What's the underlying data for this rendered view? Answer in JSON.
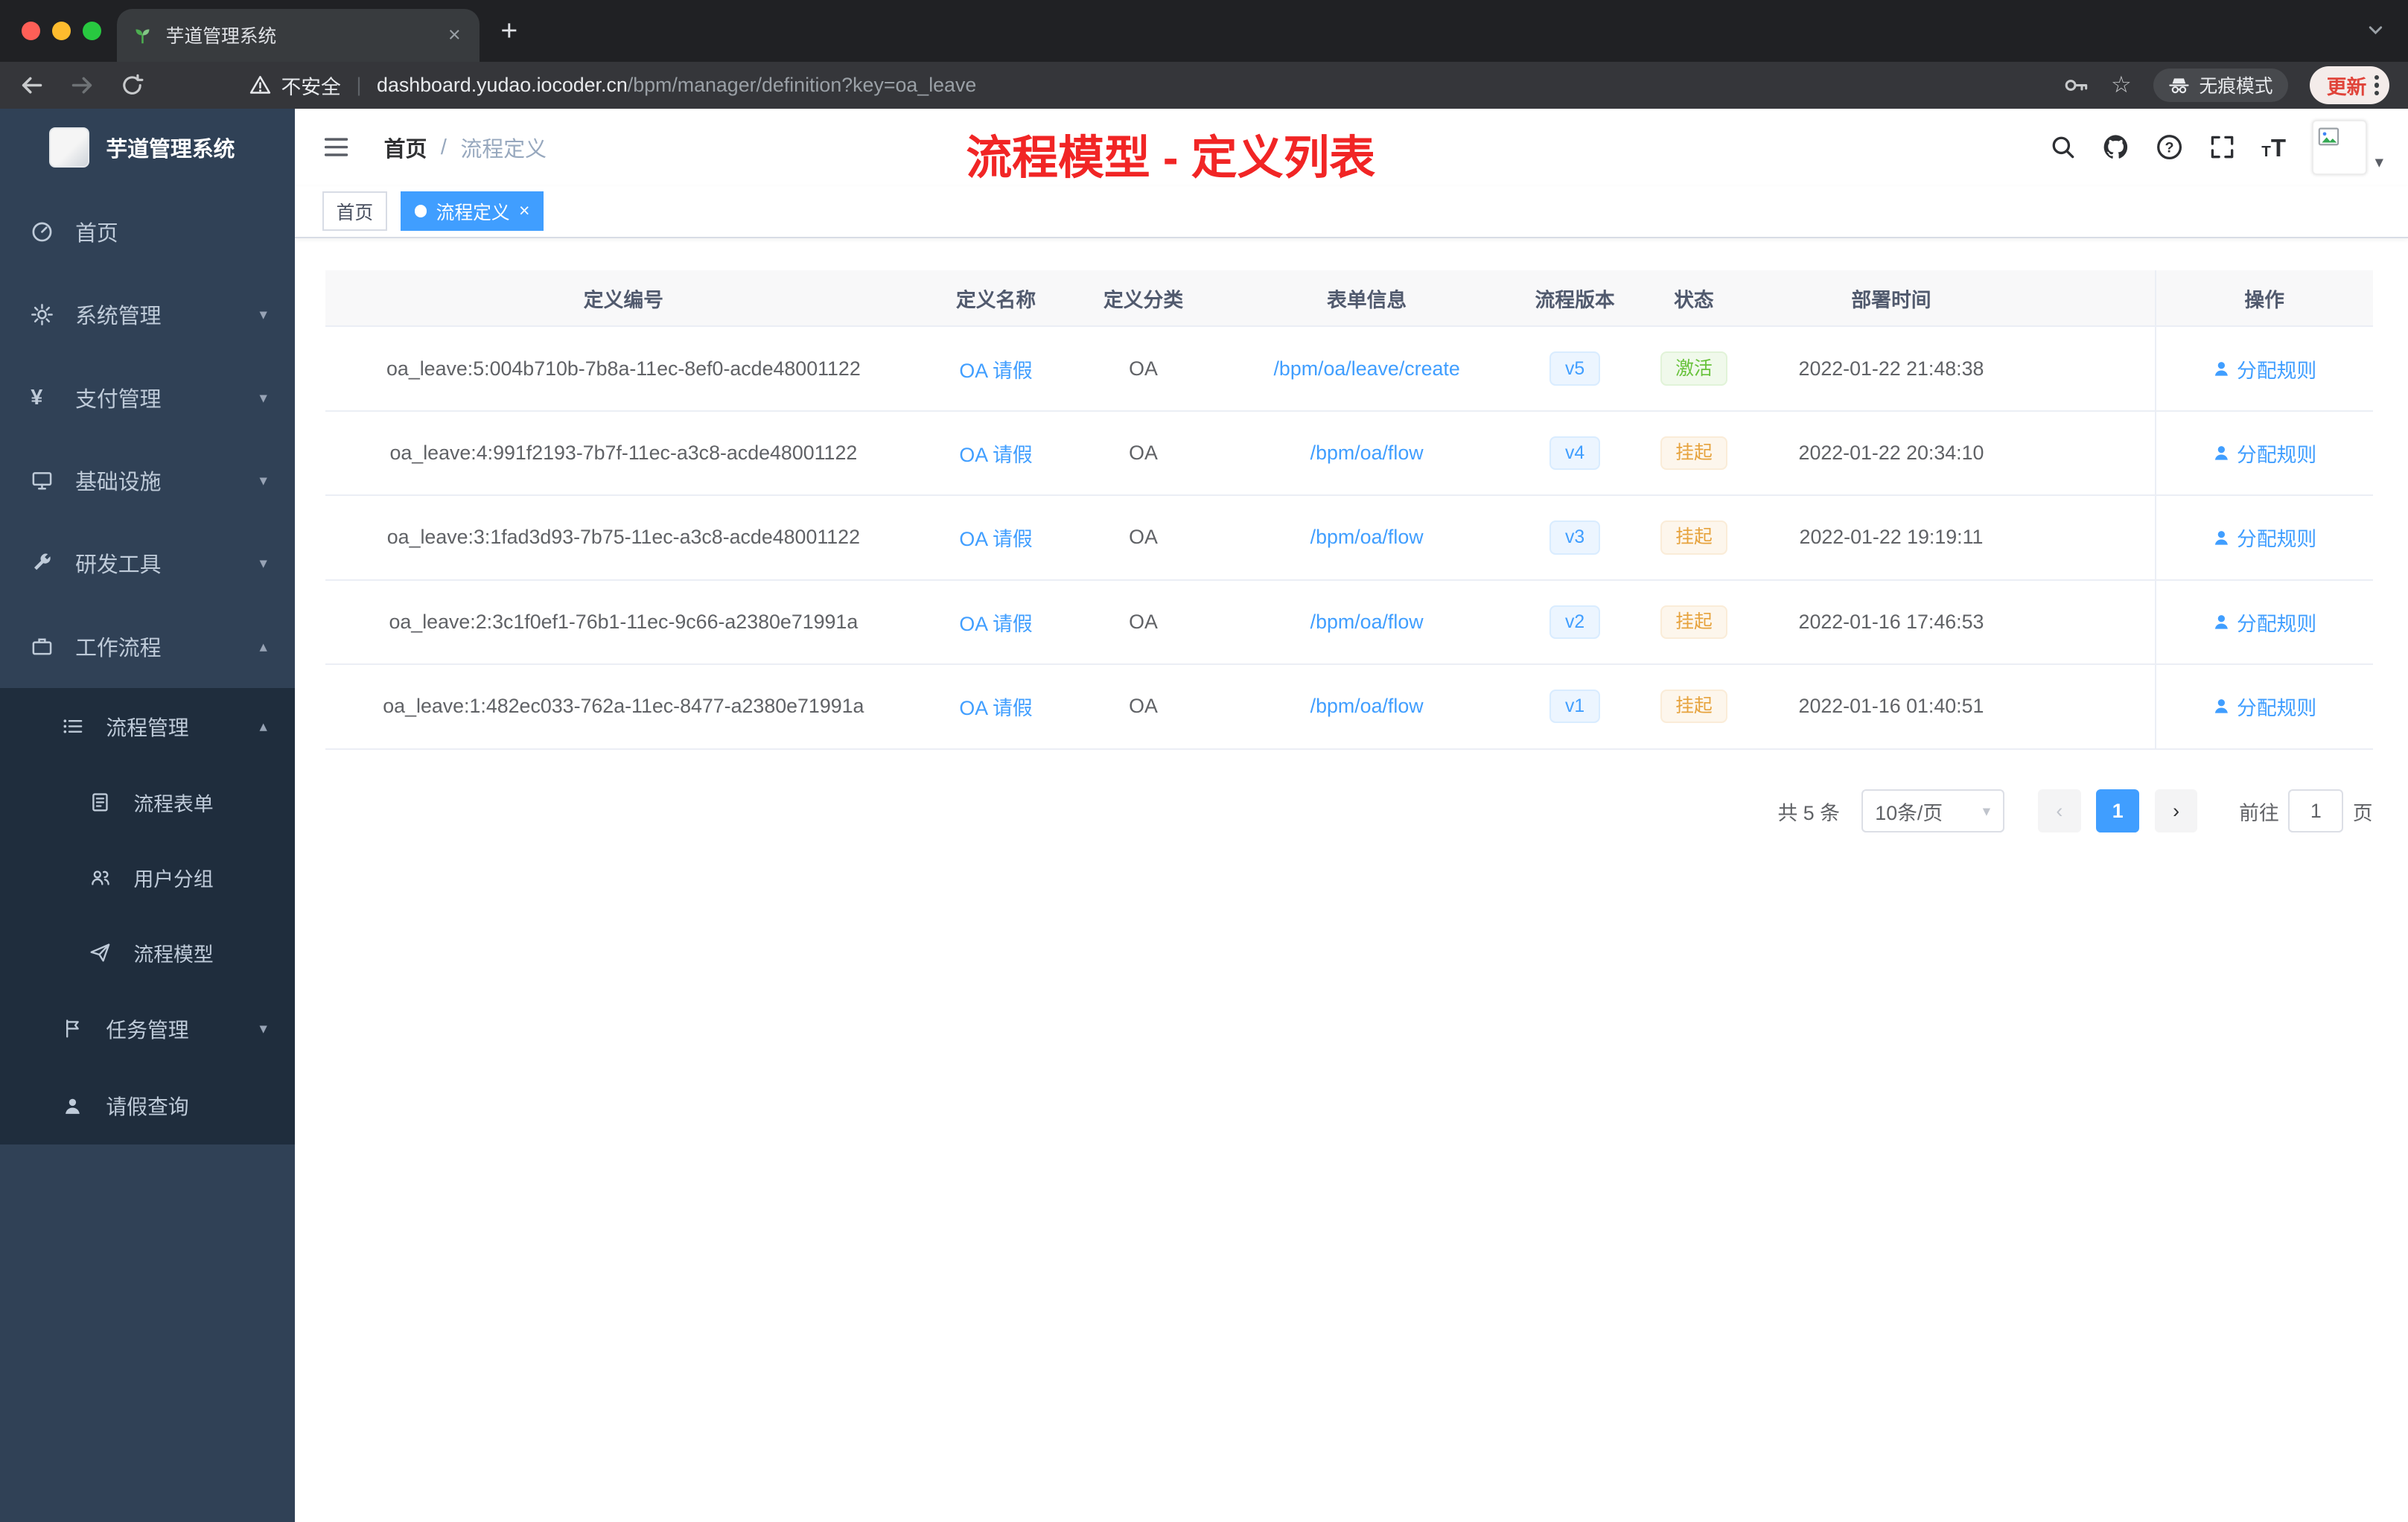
{
  "browser": {
    "tab_title": "芋道管理系统",
    "security_label": "不安全",
    "url_domain": "dashboard.yudao.iocoder.cn",
    "url_path": "/bpm/manager/definition?key=oa_leave",
    "incognito_label": "无痕模式",
    "update_label": "更新"
  },
  "sidebar": {
    "brand": "芋道管理系统",
    "menu": [
      {
        "label": "首页"
      },
      {
        "label": "系统管理"
      },
      {
        "label": "支付管理"
      },
      {
        "label": "基础设施"
      },
      {
        "label": "研发工具"
      },
      {
        "label": "工作流程"
      },
      {
        "label": "流程管理"
      },
      {
        "label": "流程表单"
      },
      {
        "label": "用户分组"
      },
      {
        "label": "流程模型"
      },
      {
        "label": "任务管理"
      },
      {
        "label": "请假查询"
      }
    ]
  },
  "header": {
    "breadcrumb_home": "首页",
    "breadcrumb_current": "流程定义",
    "annotation": "流程模型 - 定义列表",
    "annotation_color": "#f12525"
  },
  "tags_view": {
    "tags": [
      {
        "label": "首页",
        "active": false
      },
      {
        "label": "流程定义",
        "active": true
      }
    ]
  },
  "table": {
    "columns": [
      "定义编号",
      "定义名称",
      "定义分类",
      "表单信息",
      "流程版本",
      "状态",
      "部署时间",
      "操作"
    ],
    "rows": [
      {
        "id": "oa_leave:5:004b710b-7b8a-11ec-8ef0-acde48001122",
        "name": "OA 请假",
        "category": "OA",
        "form": "/bpm/oa/leave/create",
        "version": "v5",
        "status": "激活",
        "status_type": "success",
        "time": "2022-01-22 21:48:38",
        "action": "分配规则"
      },
      {
        "id": "oa_leave:4:991f2193-7b7f-11ec-a3c8-acde48001122",
        "name": "OA 请假",
        "category": "OA",
        "form": "/bpm/oa/flow",
        "version": "v4",
        "status": "挂起",
        "status_type": "warning",
        "time": "2022-01-22 20:34:10",
        "action": "分配规则"
      },
      {
        "id": "oa_leave:3:1fad3d93-7b75-11ec-a3c8-acde48001122",
        "name": "OA 请假",
        "category": "OA",
        "form": "/bpm/oa/flow",
        "version": "v3",
        "status": "挂起",
        "status_type": "warning",
        "time": "2022-01-22 19:19:11",
        "action": "分配规则"
      },
      {
        "id": "oa_leave:2:3c1f0ef1-76b1-11ec-9c66-a2380e71991a",
        "name": "OA 请假",
        "category": "OA",
        "form": "/bpm/oa/flow",
        "version": "v2",
        "status": "挂起",
        "status_type": "warning",
        "time": "2022-01-16 17:46:53",
        "action": "分配规则"
      },
      {
        "id": "oa_leave:1:482ec033-762a-11ec-8477-a2380e71991a",
        "name": "OA 请假",
        "category": "OA",
        "form": "/bpm/oa/flow",
        "version": "v1",
        "status": "挂起",
        "status_type": "warning",
        "time": "2022-01-16 01:40:51",
        "action": "分配规则"
      }
    ]
  },
  "pagination": {
    "total": "共 5 条",
    "page_size": "10条/页",
    "page": "1",
    "goto_label": "前往",
    "goto_value": "1",
    "unit_label": "页"
  },
  "colors": {
    "accent": "#409eff",
    "success": "#67c23a",
    "warning": "#e6a23c",
    "sidebar_bg": "#304156",
    "submenu_bg": "#1f2d3d",
    "tag_active_bg": "#409eff"
  }
}
